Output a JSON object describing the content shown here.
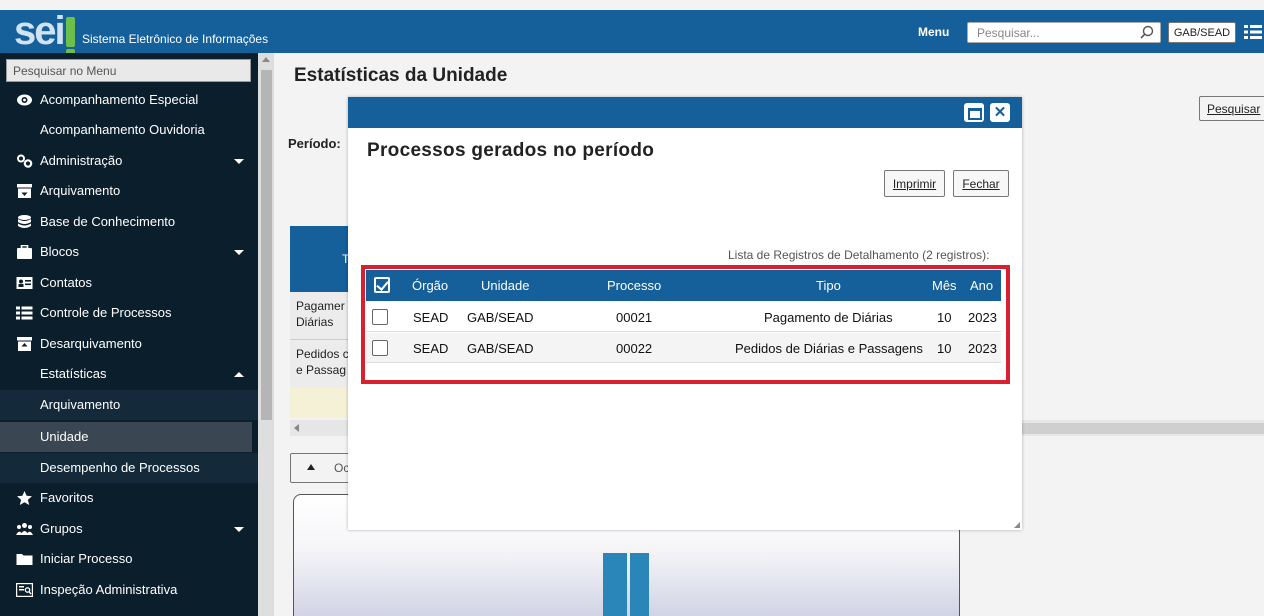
{
  "header": {
    "system_name": "Sistema Eletrônico de Informações",
    "logo_text": "sei",
    "menu_label": "Menu",
    "search_placeholder": "Pesquisar...",
    "unit": "GAB/SEAD",
    "brand_color": "#155f9a"
  },
  "sidebar": {
    "search_placeholder": "Pesquisar no Menu",
    "items": [
      {
        "label": "Acompanhamento Especial",
        "icon": "eye-icon"
      },
      {
        "label": "Acompanhamento Ouvidoria",
        "icon": ""
      },
      {
        "label": "Administração",
        "icon": "gears-icon",
        "expandable": true
      },
      {
        "label": "Arquivamento",
        "icon": "archive-box-icon"
      },
      {
        "label": "Base de Conhecimento",
        "icon": "database-icon"
      },
      {
        "label": "Blocos",
        "icon": "briefcase-icon",
        "expandable": true
      },
      {
        "label": "Contatos",
        "icon": "contact-card-icon"
      },
      {
        "label": "Controle de Processos",
        "icon": "list-icon"
      },
      {
        "label": "Desarquivamento",
        "icon": "unarchive-box-icon"
      },
      {
        "label": "Estatísticas",
        "icon": "",
        "expanded": true
      },
      {
        "label": "Arquivamento",
        "submenu": true
      },
      {
        "label": "Unidade",
        "submenu": true,
        "active": true
      },
      {
        "label": "Desempenho de Processos",
        "submenu": true
      },
      {
        "label": "Favoritos",
        "icon": "star-icon"
      },
      {
        "label": "Grupos",
        "icon": "users-icon",
        "expandable": true
      },
      {
        "label": "Iniciar Processo",
        "icon": "folder-icon"
      },
      {
        "label": "Inspeção Administrativa",
        "icon": "inspection-icon"
      }
    ]
  },
  "page": {
    "title": "Estatísticas da Unidade",
    "period_label": "Período:",
    "search_button": "Pesquisar",
    "table_header_fragment": "T",
    "row1_fragment": "Pagamer Diárias",
    "row2_fragment": "Pedidos c e Passag",
    "toggle_fragment": "Oc"
  },
  "modal": {
    "title": "Processos gerados no período",
    "print_button": "Imprimir",
    "close_button": "Fechar",
    "caption": "Lista de Registros de Detalhamento (2 registros):",
    "columns": [
      "Órgão",
      "Unidade",
      "Processo",
      "Tipo",
      "Mês",
      "Ano"
    ],
    "rows": [
      {
        "orgao": "SEAD",
        "unidade": "GAB/SEAD",
        "processo": "00021",
        "tipo": "Pagamento de Diárias",
        "mes": "10",
        "ano": "2023"
      },
      {
        "orgao": "SEAD",
        "unidade": "GAB/SEAD",
        "processo": "00022",
        "tipo": "Pedidos de Diárias e Passagens",
        "mes": "10",
        "ano": "2023"
      }
    ],
    "highlight_color": "#d9202e"
  }
}
